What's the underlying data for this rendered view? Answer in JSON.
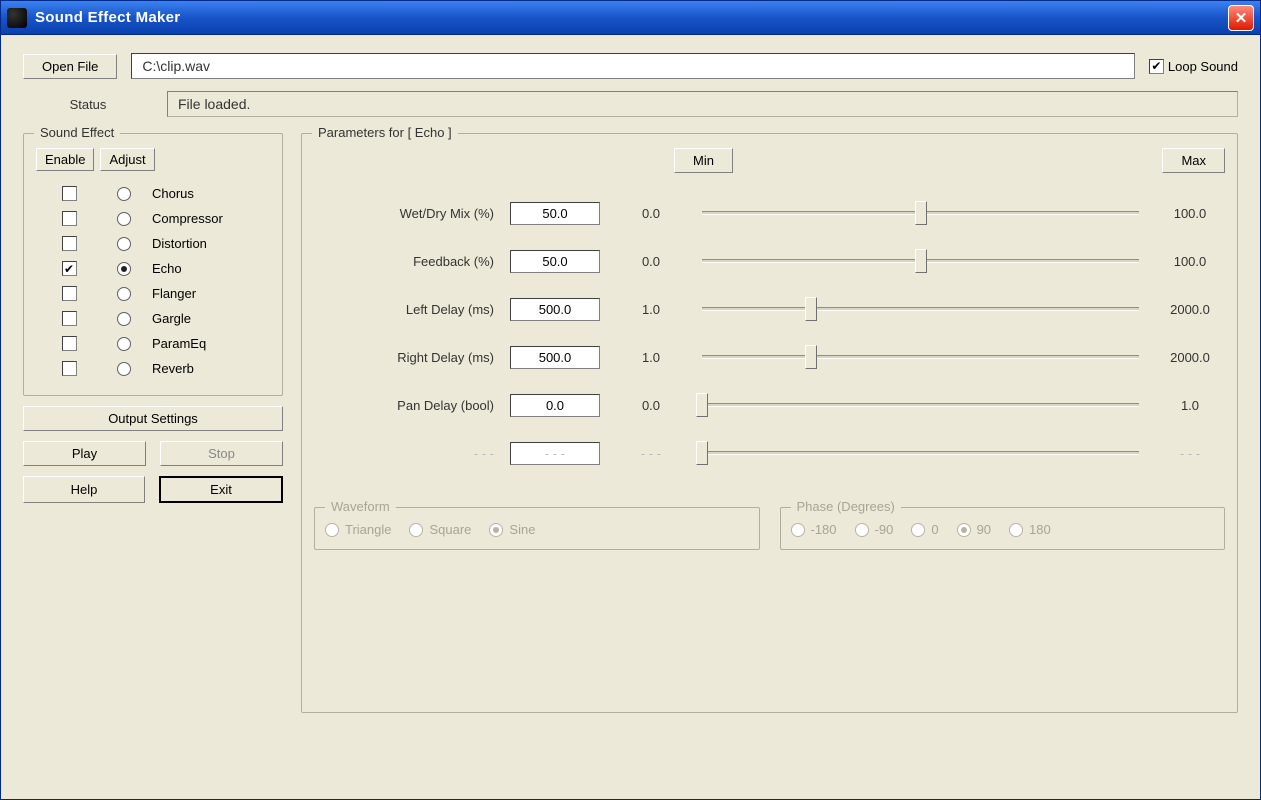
{
  "window": {
    "title": "Sound Effect Maker"
  },
  "toolbar": {
    "open_file": "Open File",
    "file_path": "C:\\clip.wav",
    "loop_sound_label": "Loop Sound",
    "loop_sound_checked": true
  },
  "status": {
    "label": "Status",
    "value": "File loaded."
  },
  "sound_effect": {
    "legend": "Sound Effect",
    "enable_hdr": "Enable",
    "adjust_hdr": "Adjust",
    "effects": [
      {
        "name": "Chorus",
        "enabled": false,
        "selected": false
      },
      {
        "name": "Compressor",
        "enabled": false,
        "selected": false
      },
      {
        "name": "Distortion",
        "enabled": false,
        "selected": false
      },
      {
        "name": "Echo",
        "enabled": true,
        "selected": true
      },
      {
        "name": "Flanger",
        "enabled": false,
        "selected": false
      },
      {
        "name": "Gargle",
        "enabled": false,
        "selected": false
      },
      {
        "name": "ParamEq",
        "enabled": false,
        "selected": false
      },
      {
        "name": "Reverb",
        "enabled": false,
        "selected": false
      }
    ]
  },
  "buttons": {
    "output_settings": "Output Settings",
    "play": "Play",
    "stop": "Stop",
    "help": "Help",
    "exit": "Exit"
  },
  "parameters": {
    "legend": "Parameters for [ Echo ]",
    "min_btn": "Min",
    "max_btn": "Max",
    "rows": [
      {
        "label": "Wet/Dry Mix (%)",
        "value": "50.0",
        "min": "0.0",
        "max": "100.0",
        "pos": 50
      },
      {
        "label": "Feedback (%)",
        "value": "50.0",
        "min": "0.0",
        "max": "100.0",
        "pos": 50
      },
      {
        "label": "Left Delay (ms)",
        "value": "500.0",
        "min": "1.0",
        "max": "2000.0",
        "pos": 25
      },
      {
        "label": "Right Delay (ms)",
        "value": "500.0",
        "min": "1.0",
        "max": "2000.0",
        "pos": 25
      },
      {
        "label": "Pan Delay (bool)",
        "value": "0.0",
        "min": "0.0",
        "max": "1.0",
        "pos": 0
      },
      {
        "label": "- - -",
        "value": "- - -",
        "min": "- - -",
        "max": "- - -",
        "pos": 0,
        "disabled": true
      }
    ],
    "waveform": {
      "legend": "Waveform",
      "options": [
        "Triangle",
        "Square",
        "Sine"
      ],
      "selected": "Sine"
    },
    "phase": {
      "legend": "Phase (Degrees)",
      "options": [
        "-180",
        "-90",
        "0",
        "90",
        "180"
      ],
      "selected": "90"
    }
  }
}
